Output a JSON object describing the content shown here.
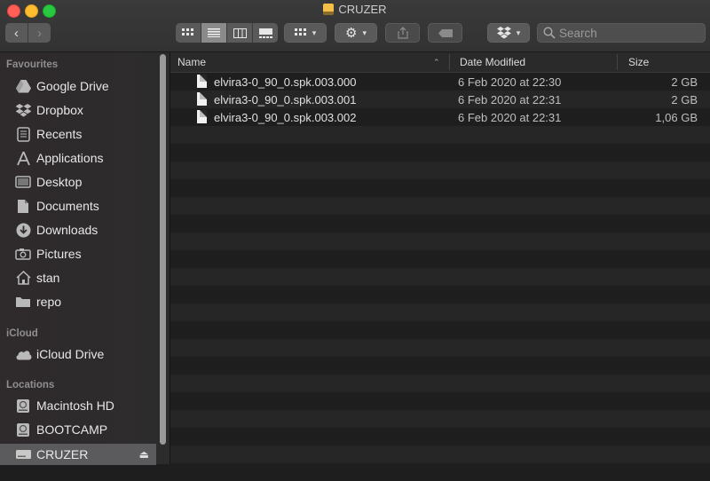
{
  "window": {
    "title": "CRUZER"
  },
  "toolbar": {
    "back_icon": "chevron-left-icon",
    "forward_icon": "chevron-right-icon",
    "view_modes": [
      "icon-view",
      "list-view",
      "column-view",
      "gallery-view"
    ],
    "search_placeholder": "Search"
  },
  "sidebar": {
    "sections": {
      "favourites": "Favourites",
      "icloud": "iCloud",
      "locations": "Locations"
    },
    "favourites": [
      {
        "label": "Google Drive",
        "icon": "google-drive-icon"
      },
      {
        "label": "Dropbox",
        "icon": "dropbox-icon"
      },
      {
        "label": "Recents",
        "icon": "recents-icon"
      },
      {
        "label": "Applications",
        "icon": "applications-icon"
      },
      {
        "label": "Desktop",
        "icon": "desktop-icon"
      },
      {
        "label": "Documents",
        "icon": "documents-icon"
      },
      {
        "label": "Downloads",
        "icon": "downloads-icon"
      },
      {
        "label": "Pictures",
        "icon": "pictures-icon"
      },
      {
        "label": "stan",
        "icon": "home-icon"
      },
      {
        "label": "repo",
        "icon": "folder-icon"
      }
    ],
    "icloud": [
      {
        "label": "iCloud Drive",
        "icon": "cloud-icon"
      }
    ],
    "locations": [
      {
        "label": "Macintosh HD",
        "icon": "disk-icon"
      },
      {
        "label": "BOOTCAMP",
        "icon": "disk-icon"
      },
      {
        "label": "CRUZER",
        "icon": "usb-drive-icon",
        "selected": true
      }
    ]
  },
  "columns": {
    "name": "Name",
    "date": "Date Modified",
    "size": "Size"
  },
  "files": [
    {
      "name": "elvira3-0_90_0.spk.003.000",
      "date": "6 Feb 2020 at 22:30",
      "size": "2 GB"
    },
    {
      "name": "elvira3-0_90_0.spk.003.001",
      "date": "6 Feb 2020 at 22:31",
      "size": "2 GB"
    },
    {
      "name": "elvira3-0_90_0.spk.003.002",
      "date": "6 Feb 2020 at 22:31",
      "size": "1,06 GB"
    }
  ]
}
